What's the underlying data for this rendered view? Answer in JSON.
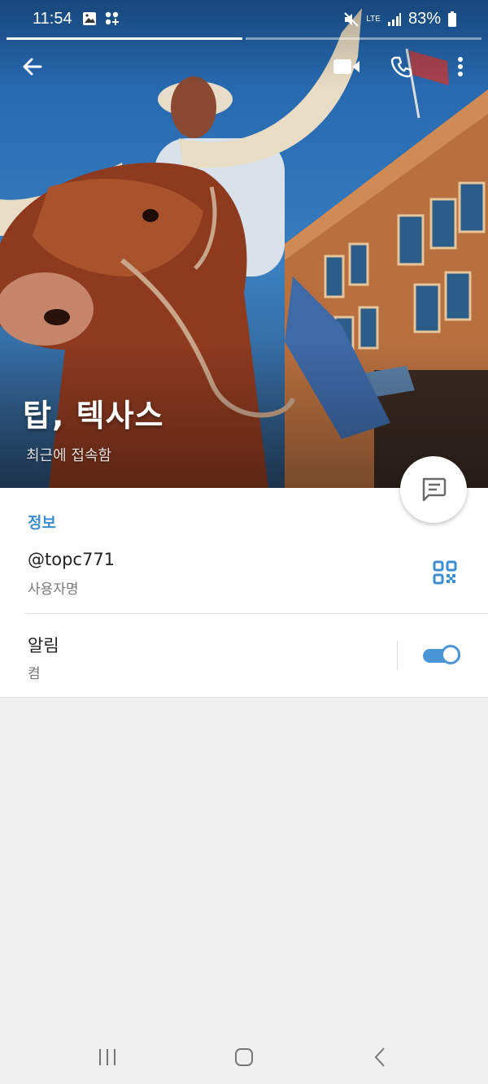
{
  "status_bar": {
    "time": "11:54",
    "network": "LTE",
    "battery": "83%"
  },
  "appbar": {
    "back_icon": "arrow-left-icon",
    "video_icon": "video-call-icon",
    "call_icon": "phone-icon",
    "more_icon": "more-vertical-icon"
  },
  "profile": {
    "name": "탑, 텍사스",
    "last_seen": "최근에 접속함"
  },
  "info": {
    "section_title": "정보",
    "username": "@topc771",
    "username_label": "사용자명",
    "notifications_label": "알림",
    "notifications_value": "켬",
    "notifications_on": true
  },
  "colors": {
    "accent": "#3b8fd0",
    "toggle": "#4a95d6",
    "background": "#efefef"
  }
}
